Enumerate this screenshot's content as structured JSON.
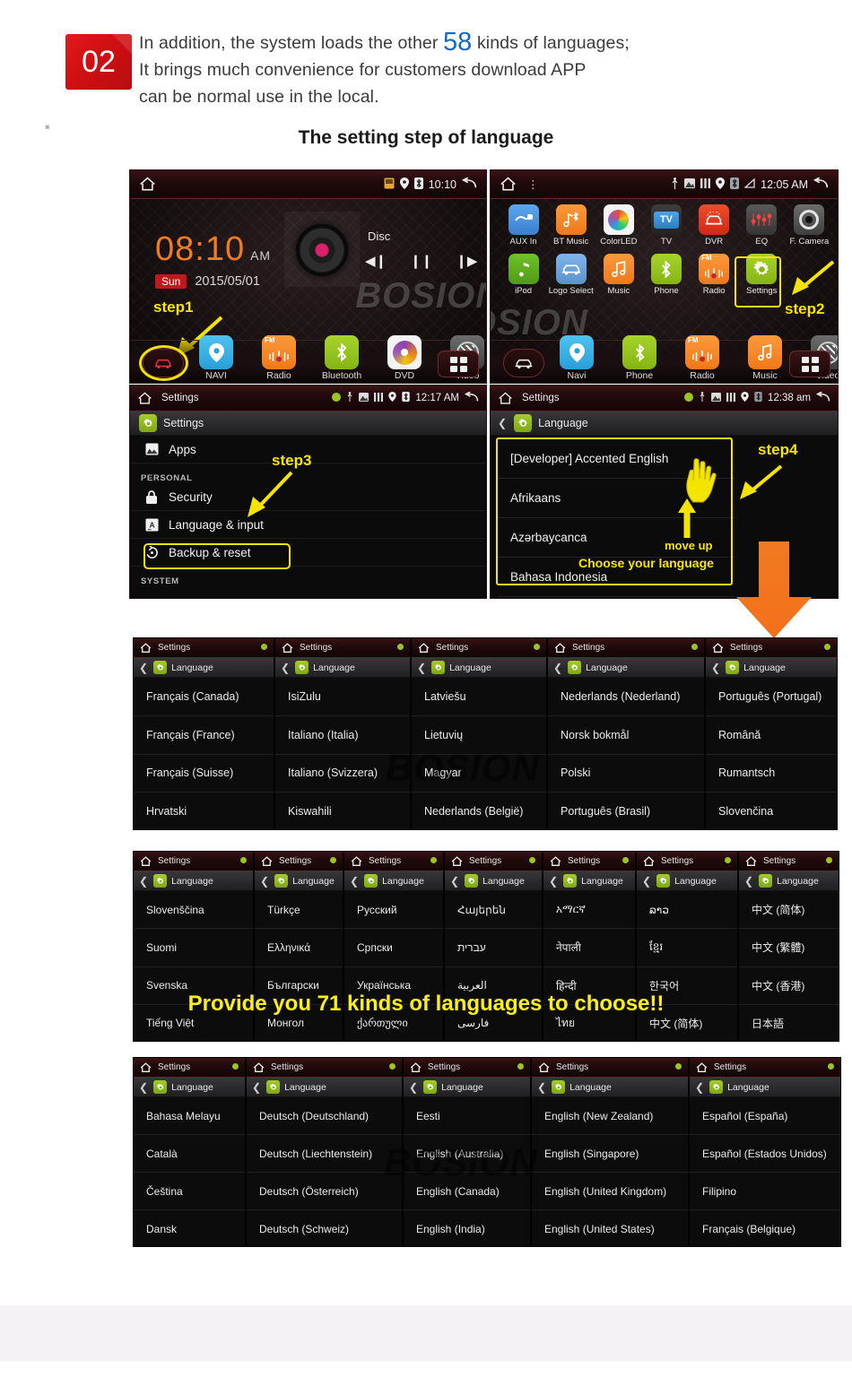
{
  "header": {
    "badge_number": "02",
    "intro_part1": "In addition, the system loads the other ",
    "intro_number": "58",
    "intro_part2": " kinds of languages;",
    "intro_line2": "It brings much convenience for customers download APP",
    "intro_line3": "can be normal use in the local.",
    "section_title": "The setting step of language"
  },
  "watermark": {
    "text": "BOSION"
  },
  "banner": {
    "text": "Provide you 71 kinds of languages to choose!!"
  },
  "screen1": {
    "status": {
      "time": "10:10",
      "icons": [
        "sd-card-icon",
        "location-icon",
        "bluetooth-icon"
      ]
    },
    "clock": {
      "time": "08:10",
      "ampm": "AM",
      "day": "Sun",
      "date": "2015/05/01"
    },
    "media": {
      "source": "Disc",
      "prev": "◀❙",
      "pause": "❙❙",
      "next": "❙▶"
    },
    "step_label": "step1",
    "dock": [
      {
        "label": "NAVI",
        "icon": "location-pin-icon"
      },
      {
        "label": "Radio",
        "icon": "fm-radio-icon"
      },
      {
        "label": "Bluetooth",
        "icon": "bluetooth-icon"
      },
      {
        "label": "DVD",
        "icon": "disc-icon"
      },
      {
        "label": "Video",
        "icon": "video-icon"
      }
    ]
  },
  "screen2": {
    "status": {
      "time": "12:05 AM",
      "icons": [
        "usb-icon",
        "screenshot-icon",
        "equalizer-icon",
        "location-icon",
        "bluetooth-icon",
        "signal-icon"
      ]
    },
    "step_label": "step2",
    "selected_app": "Settings",
    "apps": [
      {
        "label": "AUX In",
        "icon": "aux-plug-icon"
      },
      {
        "label": "BT Music",
        "icon": "bluetooth-music-icon"
      },
      {
        "label": "ColorLED",
        "icon": "color-wheel-icon"
      },
      {
        "label": "TV",
        "icon": "tv-icon"
      },
      {
        "label": "DVR",
        "icon": "dvr-car-icon"
      },
      {
        "label": "EQ",
        "icon": "equalizer-icon"
      },
      {
        "label": "F. Camera",
        "icon": "front-camera-icon"
      },
      {
        "label": "iPod",
        "icon": "music-note-icon"
      },
      {
        "label": "Logo Select",
        "icon": "car-logo-icon"
      },
      {
        "label": "Music",
        "icon": "music-icon"
      },
      {
        "label": "Phone",
        "icon": "bluetooth-phone-icon"
      },
      {
        "label": "Radio",
        "icon": "fm-radio-icon"
      },
      {
        "label": "Settings",
        "icon": "gear-icon"
      }
    ],
    "dock": [
      {
        "label": "Navi",
        "icon": "location-pin-icon"
      },
      {
        "label": "Phone",
        "icon": "bluetooth-icon"
      },
      {
        "label": "Radio",
        "icon": "fm-radio-icon"
      },
      {
        "label": "Music",
        "icon": "music-icon"
      },
      {
        "label": "Video",
        "icon": "video-icon"
      }
    ]
  },
  "screen3": {
    "status": {
      "title": "Settings",
      "time": "12:17 AM"
    },
    "sub_header": "Settings",
    "step_label": "step3",
    "highlighted_row": "Language & input",
    "rows": [
      {
        "type": "item",
        "label": "Apps",
        "icon": "apps-icon"
      },
      {
        "type": "category",
        "label": "PERSONAL"
      },
      {
        "type": "item",
        "label": "Security",
        "icon": "lock-icon"
      },
      {
        "type": "item",
        "label": "Language & input",
        "icon": "keyboard-a-icon"
      },
      {
        "type": "item",
        "label": "Backup & reset",
        "icon": "restore-icon"
      },
      {
        "type": "category",
        "label": "SYSTEM"
      }
    ]
  },
  "screen4": {
    "status": {
      "title": "Settings",
      "time": "12:38 am"
    },
    "sub_header": "Language",
    "step_label": "step4",
    "hint_move": "move up",
    "hint_choose": "Choose your language",
    "items": [
      "[Developer] Accented English",
      "Afrikaans",
      "Azərbaycanca",
      "Bahasa Indonesia"
    ]
  },
  "panel_common": {
    "status_title": "Settings",
    "sub_header": "Language"
  },
  "grid_rows": [
    {
      "panels": [
        {
          "items": [
            "Français (Canada)",
            "Français (France)",
            "Français (Suisse)",
            "Hrvatski"
          ]
        },
        {
          "items": [
            "IsiZulu",
            "Italiano (Italia)",
            "Italiano (Svizzera)",
            "Kiswahili"
          ]
        },
        {
          "items": [
            "Latviešu",
            "Lietuvių",
            "Magyar",
            "Nederlands (België)"
          ]
        },
        {
          "items": [
            "Nederlands (Nederland)",
            "Norsk bokmål",
            "Polski",
            "Português (Brasil)"
          ]
        },
        {
          "items": [
            "Português (Portugal)",
            "Română",
            "Rumantsch",
            "Slovenčina"
          ]
        }
      ]
    },
    {
      "panels": [
        {
          "items": [
            "Slovenščina",
            "Suomi",
            "Svenska",
            "Tiếng Việt"
          ]
        },
        {
          "items": [
            "Türkçe",
            "Ελληνικά",
            "Български",
            "Монгол"
          ]
        },
        {
          "items": [
            "Русский",
            "Српски",
            "Українська",
            "ქართული"
          ]
        },
        {
          "items": [
            "Հայերեն",
            "עברית",
            "العربية",
            "فارسی"
          ]
        },
        {
          "items": [
            "አማርኛ",
            "नेपाली",
            "हिन्दी",
            "ไทย"
          ]
        },
        {
          "items": [
            "ລາວ",
            "ខ្មែរ",
            "한국어",
            "中文 (简体)"
          ]
        },
        {
          "items": [
            "中文 (简体)",
            "中文 (繁體)",
            "中文 (香港)",
            "日本語"
          ]
        }
      ]
    },
    {
      "panels": [
        {
          "items": [
            "Bahasa Melayu",
            "Català",
            "Čeština",
            "Dansk"
          ]
        },
        {
          "items": [
            "Deutsch (Deutschland)",
            "Deutsch (Liechtenstein)",
            "Deutsch (Österreich)",
            "Deutsch (Schweiz)"
          ]
        },
        {
          "items": [
            "Eesti",
            "English (Australia)",
            "English (Canada)",
            "English (India)"
          ]
        },
        {
          "items": [
            "English (New Zealand)",
            "English (Singapore)",
            "English (United Kingdom)",
            "English (United States)"
          ]
        },
        {
          "items": [
            "Español (España)",
            "Español (Estados Unidos)",
            "Filipino",
            "Français (Belgique)"
          ]
        }
      ]
    }
  ],
  "colors": {
    "badge_red": "#d31418",
    "accent_blue": "#1567c4",
    "highlight_yellow": "#f3e500",
    "orange_arrow": "#f4701b",
    "green_gear": "#9ac522"
  }
}
